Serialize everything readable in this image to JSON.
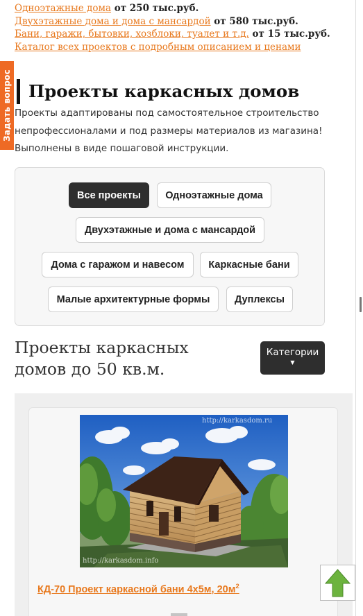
{
  "top_links": [
    {
      "link": "Одноэтажные дома",
      "price": " от 250 тыс.руб."
    },
    {
      "link": "Двухэтажные дома и дома с мансардой",
      "price": " от 580 тыс.руб."
    },
    {
      "link": "Бани, гаражи, бытовки, хозблоки, туалет и т.д.",
      "price": " от 15 тыс.руб."
    },
    {
      "link": "Каталог всех проектов с подробным описанием и ценами",
      "price": ""
    }
  ],
  "side_tab": {
    "label": "Задать вопрос"
  },
  "page_title": "Проекты каркасных домов",
  "intro": "Проекты адаптированы под самостоятельное строительство непрофессионалами и под размеры материалов из магазина! Выполнены в виде пошаговой инструкции.",
  "filters": [
    {
      "label": "Все проекты",
      "active": true
    },
    {
      "label": "Одноэтажные дома",
      "active": false
    },
    {
      "label": "Двухэтажные и дома с мансардой",
      "active": false
    },
    {
      "label": "Дома с гаражом и навесом",
      "active": false
    },
    {
      "label": "Каркасные бани",
      "active": false
    },
    {
      "label": "Малые архитектурные формы",
      "active": false
    },
    {
      "label": "Дуплексы",
      "active": false
    }
  ],
  "section_title": "Проекты каркасных домов до 50 кв.м.",
  "categories_button": {
    "label": "Категории",
    "caret": "▼"
  },
  "project_card": {
    "watermark_top": "http://karkasdom.ru",
    "watermark_bottom": "http://karkasdom.info",
    "title": "КД-70 Проект каркасной бани 4х5м, 20м",
    "title_sup": "2"
  },
  "scroll_up_icon": "arrow-up-icon",
  "colors": {
    "accent": "#ee6a24",
    "link": "#e8791e",
    "dark_button": "#2e2e2e",
    "arrow_green": "#6cb33e"
  }
}
